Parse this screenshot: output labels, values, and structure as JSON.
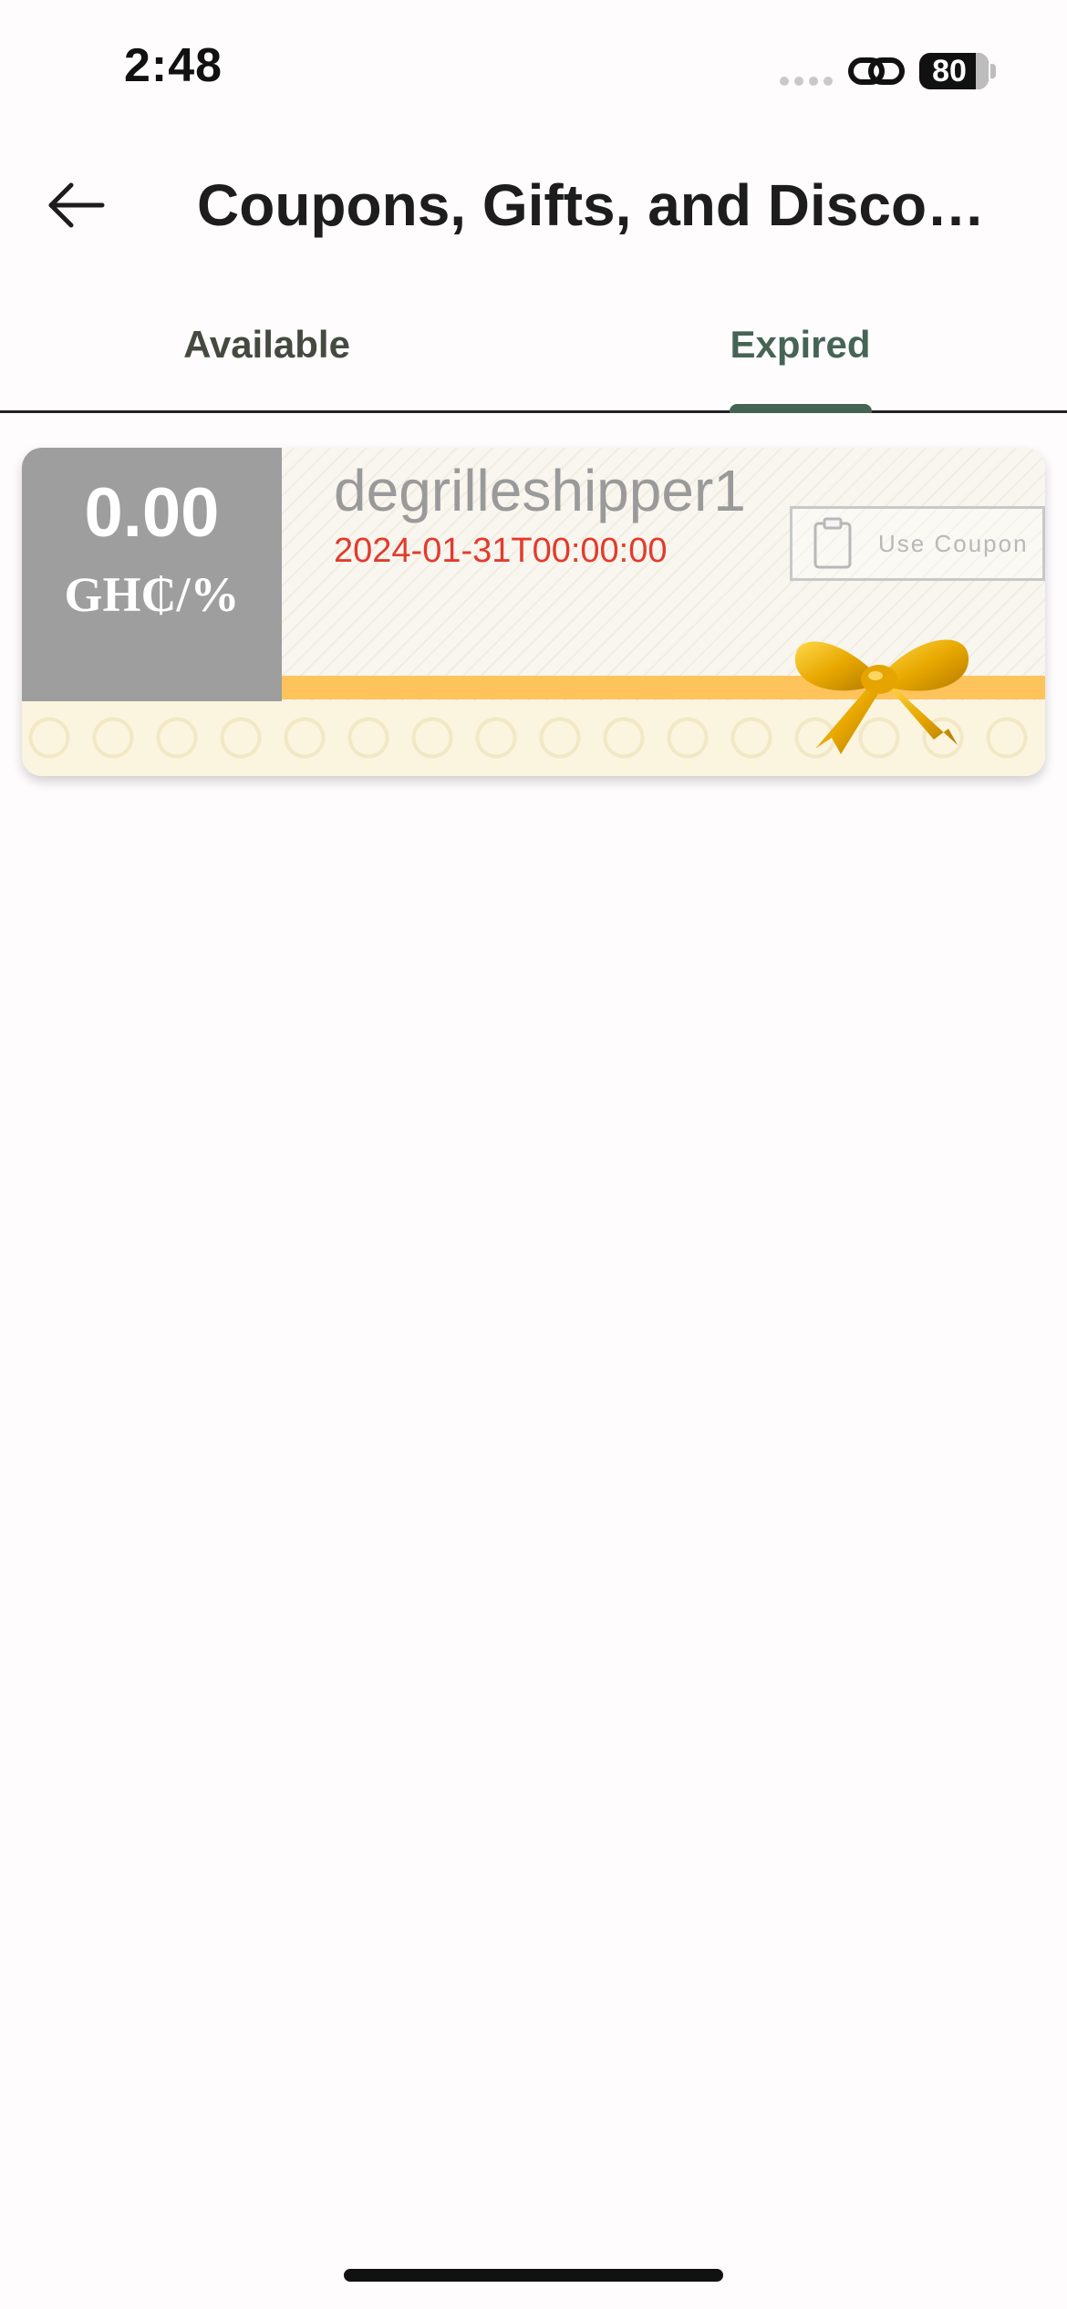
{
  "status_bar": {
    "time": "2:48",
    "battery": "80",
    "link_icon": "link-icon",
    "signal_icon": "signal-dots-icon"
  },
  "header": {
    "title": "Coupons, Gifts, and Disco…",
    "back_icon": "back-arrow-icon"
  },
  "tabs": [
    {
      "label": "Available",
      "selected": false
    },
    {
      "label": "Expired",
      "selected": true
    }
  ],
  "coupons": [
    {
      "amount": "0.00",
      "unit": "GH₵/%",
      "name": "degrilleshipper1",
      "date": "2024-01-31T00:00:00",
      "button_label": "Use Coupon",
      "button_icon": "clipboard-icon",
      "decoration_icon": "gift-bow-icon"
    }
  ],
  "colors": {
    "accent": "#466456",
    "amount_block": "#9e9e9e",
    "date_text": "#e23b2e",
    "ribbon": "#ffc35c",
    "background": "#fefcfd"
  }
}
